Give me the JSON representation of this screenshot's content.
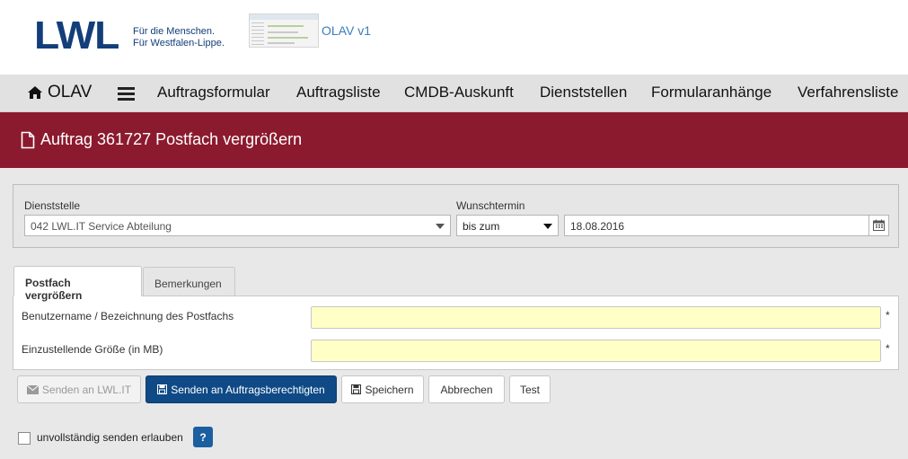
{
  "header": {
    "logo_text": "LWL",
    "tagline_line1": "Für die Menschen.",
    "tagline_line2": "Für Westfalen-Lippe.",
    "app_version_label": "OLAV v1"
  },
  "navbar": {
    "brand": "OLAV",
    "items": [
      {
        "label": "Auftragsformular"
      },
      {
        "label": "Auftragsliste"
      },
      {
        "label": "CMDB-Auskunft"
      },
      {
        "label": "Dienststellen"
      },
      {
        "label": "Formularanhänge"
      },
      {
        "label": "Verfahrensliste"
      }
    ]
  },
  "page": {
    "title": "Auftrag 361727 Postfach vergrößern"
  },
  "panel": {
    "dienststelle_label": "Dienststelle",
    "dienststelle_value": "042 LWL.IT Service Abteilung",
    "wunschtermin_label": "Wunschtermin",
    "wunschtermin_mode": "bis zum",
    "wunschtermin_date": "18.08.2016"
  },
  "tabs": [
    {
      "label": "Postfach vergrößern",
      "active": true
    },
    {
      "label": "Bemerkungen",
      "active": false
    }
  ],
  "form": {
    "fields": [
      {
        "label": "Benutzername / Bezeichnung des Postfachs",
        "value": "",
        "required_mark": "*"
      },
      {
        "label": "Einzustellende Größe (in MB)",
        "value": "",
        "required_mark": "*"
      }
    ]
  },
  "actions": {
    "send_lwlit": "Senden an LWL.IT",
    "send_auftragsberechtigte": "Senden an Auftragsberechtigten",
    "save": "Speichern",
    "cancel": "Abbrechen",
    "test": "Test"
  },
  "footer": {
    "incomplete_label": "unvollständig senden erlauben",
    "help_glyph": "?"
  },
  "colors": {
    "brand_blue": "#123e7a",
    "title_bar": "#8c1a2e",
    "primary_button": "#0f4a86",
    "required_field": "#ffffc6"
  }
}
